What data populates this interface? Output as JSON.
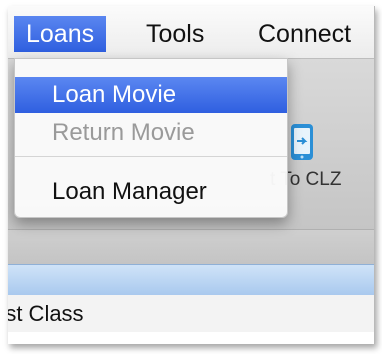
{
  "menubar": {
    "items": [
      {
        "label": "Loans",
        "active": true
      },
      {
        "label": "Tools",
        "active": false
      },
      {
        "label": "Connect",
        "active": false
      }
    ]
  },
  "dropdown": {
    "items": [
      {
        "label": "Loan Movie",
        "state": "highlighted"
      },
      {
        "label": "Return Movie",
        "state": "disabled"
      },
      {
        "label": "Loan Manager",
        "state": "enabled"
      }
    ]
  },
  "toolbar": {
    "connect_button_label": "t To CLZ",
    "connect_icon": "sync-phone-icon"
  },
  "list": {
    "row_text": "rst Class"
  },
  "colors": {
    "highlight": "#3c6ce6",
    "disabled_text": "#9a9a9a",
    "icon_blue": "#2b8fd6"
  }
}
